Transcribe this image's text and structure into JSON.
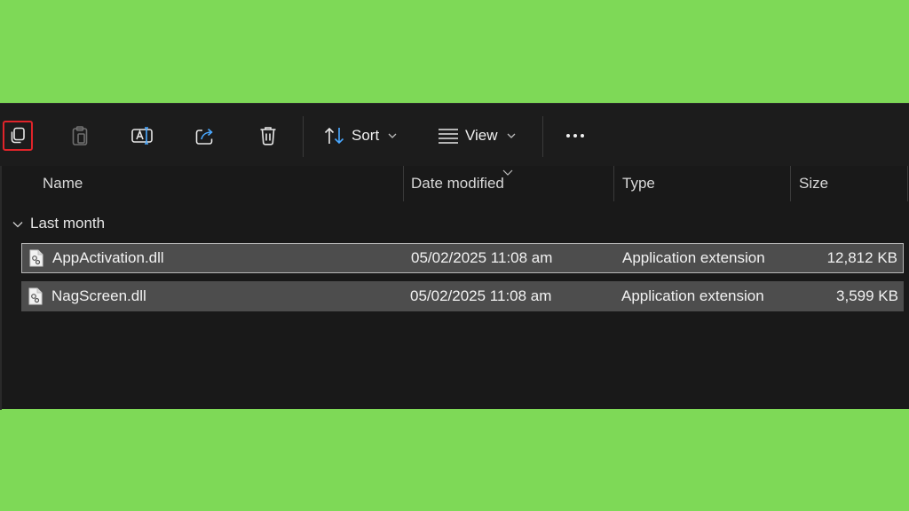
{
  "toolbar": {
    "copy_icon": "copy-icon",
    "paste_icon": "paste-icon",
    "rename_icon": "rename-icon",
    "share_icon": "share-icon",
    "delete_icon": "delete-icon",
    "sort_label": "Sort",
    "view_label": "View",
    "more_icon": "more-options-icon",
    "highlight_color": "#e0242a"
  },
  "columns": {
    "name": "Name",
    "date_modified": "Date modified",
    "type": "Type",
    "size": "Size"
  },
  "group": {
    "label": "Last month"
  },
  "files": [
    {
      "name": "AppActivation.dll",
      "date": "05/02/2025 11:08 am",
      "type": "Application extension",
      "size": "12,812 KB"
    },
    {
      "name": "NagScreen.dll",
      "date": "05/02/2025 11:08 am",
      "type": "Application extension",
      "size": "3,599 KB"
    }
  ],
  "colors": {
    "background": "#7ed957",
    "window": "#191919",
    "selected_row": "#4d4d4d"
  }
}
